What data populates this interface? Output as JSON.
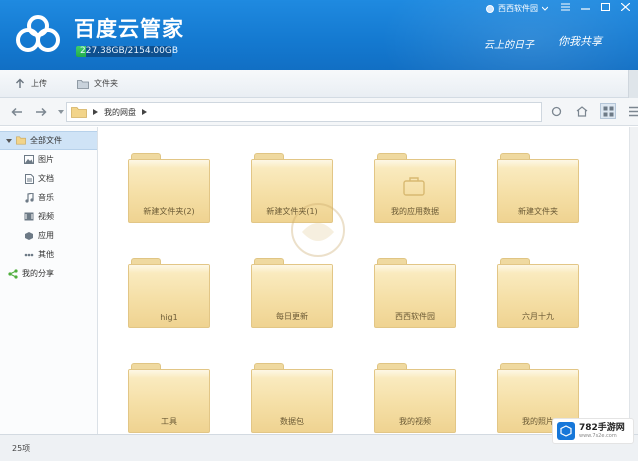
{
  "header": {
    "app_title": "百度云管家",
    "quota_text": "227.38GB/2154.00GB",
    "quota_fraction": 0.106,
    "user_name": "西西软件园",
    "slogan_left": "云上的日子",
    "slogan_right": "你我共享"
  },
  "toolbar": {
    "upload_label": "上传",
    "new_folder_label": "文件夹"
  },
  "address": {
    "crumb": "我的网盘"
  },
  "sidebar": {
    "all_files": "全部文件",
    "items": [
      {
        "label": "图片",
        "icon": "image-icon"
      },
      {
        "label": "文档",
        "icon": "document-icon"
      },
      {
        "label": "音乐",
        "icon": "music-icon"
      },
      {
        "label": "视频",
        "icon": "video-icon"
      },
      {
        "label": "应用",
        "icon": "app-icon"
      },
      {
        "label": "其他",
        "icon": "other-icon"
      }
    ],
    "share": "我的分享"
  },
  "folders": [
    {
      "label": "新建文件夹(2)"
    },
    {
      "label": "新建文件夹(1)"
    },
    {
      "label": "我的应用数据"
    },
    {
      "label": "新建文件夹"
    },
    {
      "label": "hig1"
    },
    {
      "label": "每日更新"
    },
    {
      "label": "西西软件园"
    },
    {
      "label": "六月十九"
    },
    {
      "label": "工具"
    },
    {
      "label": "数据包"
    },
    {
      "label": "我的视频"
    },
    {
      "label": "我的照片"
    }
  ],
  "status": {
    "count": "25项"
  },
  "watermark": {
    "brand": "782手游网",
    "url": "www.7s2e.com"
  },
  "colors": {
    "header_blue": "#1479d0",
    "quota_green": "#22a94b",
    "folder_yellow": "#f5dfa6",
    "selection_blue": "#cfe3f6"
  }
}
